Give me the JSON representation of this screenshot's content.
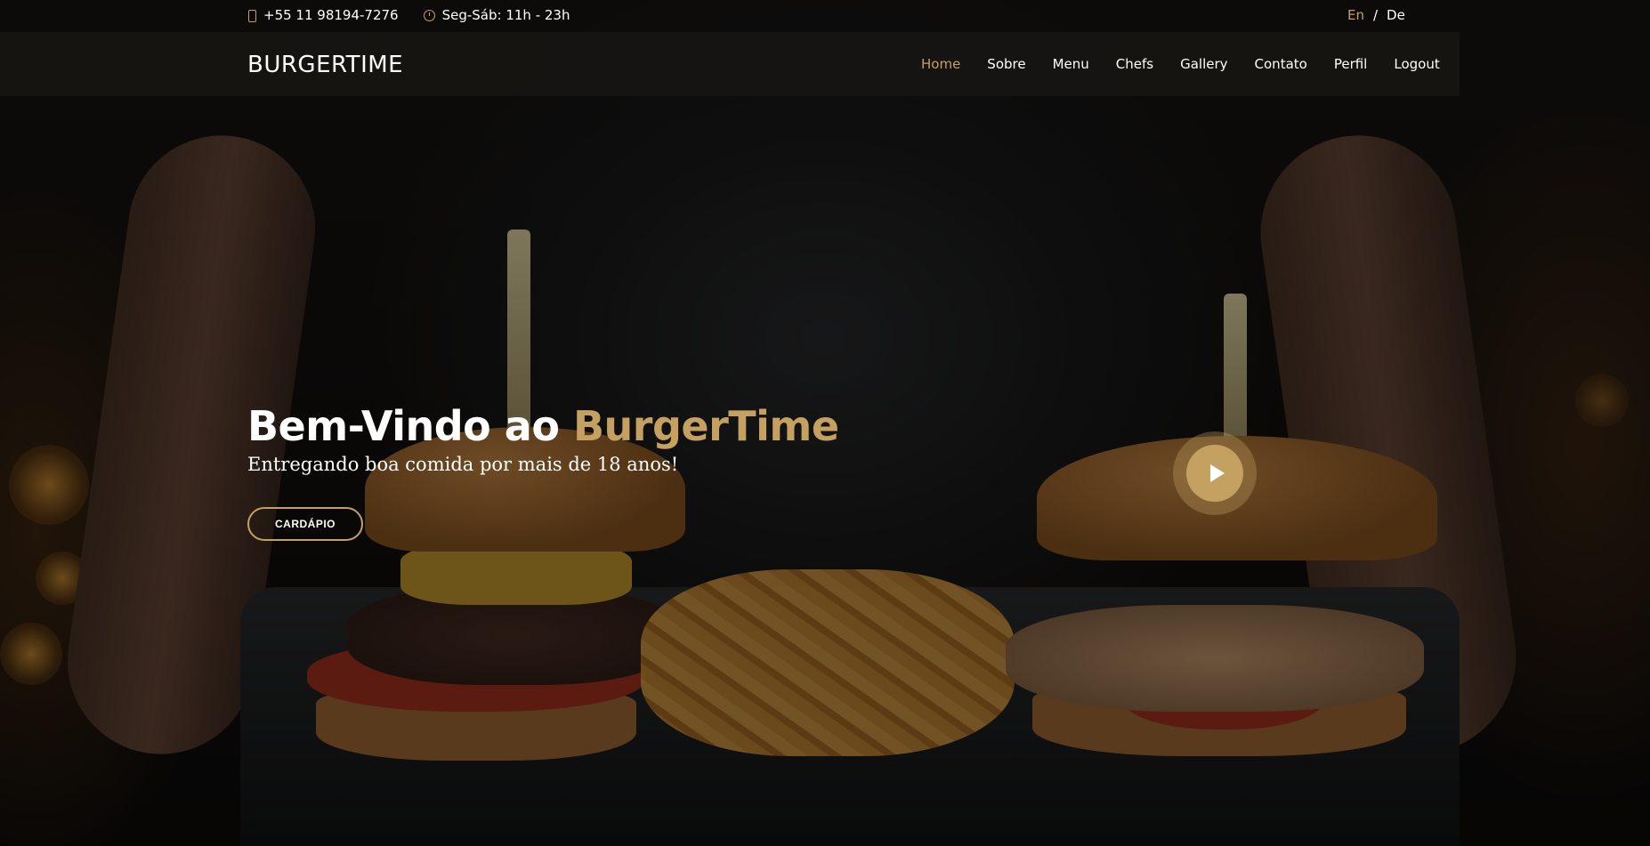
{
  "topbar": {
    "phone": "+55 11 98194-7276",
    "hours": "Seg-Sáb: 11h - 23h",
    "lang_en": "En",
    "lang_sep": "/",
    "lang_de": "De"
  },
  "header": {
    "logo": "BURGERTIME",
    "nav": [
      "Home",
      "Sobre",
      "Menu",
      "Chefs",
      "Gallery",
      "Contato",
      "Perfil",
      "Logout"
    ]
  },
  "hero": {
    "title_prefix": "Bem-Vindo ao",
    "title_brand": "BurgerTime",
    "subtitle": "Entregando boa comida por mais de 18 anos!",
    "cta_label": "CARDÁPIO",
    "play_icon": "play-icon"
  },
  "colors": {
    "accent": "#c4a061",
    "navbar_bg": "#181614"
  }
}
